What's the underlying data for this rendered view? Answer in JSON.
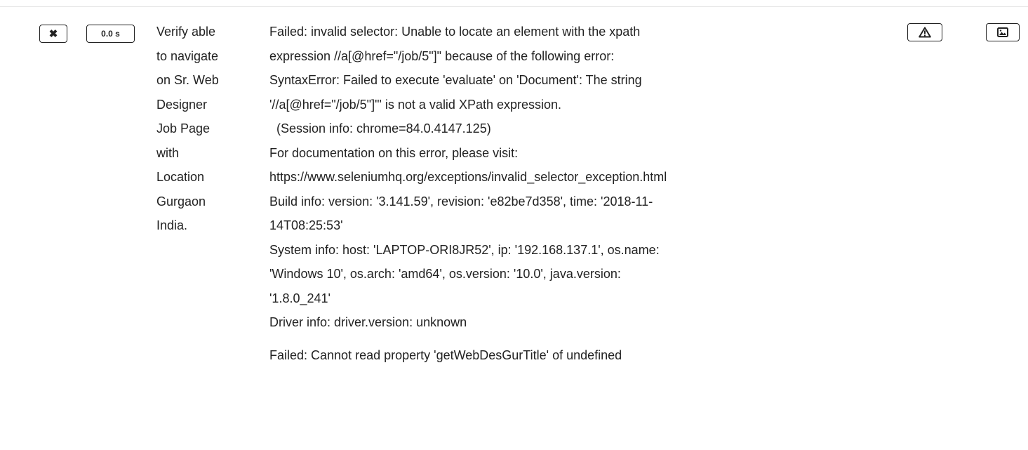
{
  "row": {
    "status_icon": "x-icon",
    "duration": "0.0 s",
    "test_name_lines": [
      "Verify able",
      "to navigate",
      "on Sr. Web",
      "Designer",
      "Job Page",
      "with",
      "Location",
      "Gurgaon",
      "India."
    ],
    "error_lines": [
      "Failed: invalid selector: Unable to locate an element with the xpath",
      "expression //a[@href=\"/job/5\"]\" because of the following error:",
      "SyntaxError: Failed to execute 'evaluate' on 'Document': The string",
      "'//a[@href=\"/job/5\"]\"' is not a valid XPath expression.",
      "  (Session info: chrome=84.0.4147.125)",
      "For documentation on this error, please visit:",
      "https://www.seleniumhq.org/exceptions/invalid_selector_exception.html",
      "Build info: version: '3.141.59', revision: 'e82be7d358', time: '2018-11-",
      "14T08:25:53'",
      "System info: host: 'LAPTOP-ORI8JR52', ip: '192.168.137.1', os.name:",
      "'Windows 10', os.arch: 'amd64', os.version: '10.0', java.version:",
      "'1.8.0_241'",
      "Driver info: driver.version: unknown"
    ],
    "second_error": "Failed: Cannot read property 'getWebDesGurTitle' of undefined",
    "warning_icon": "warning-triangle-icon",
    "image_icon": "image-icon"
  },
  "colors": {
    "text": "#222222",
    "divider": "#e6e6e6"
  }
}
